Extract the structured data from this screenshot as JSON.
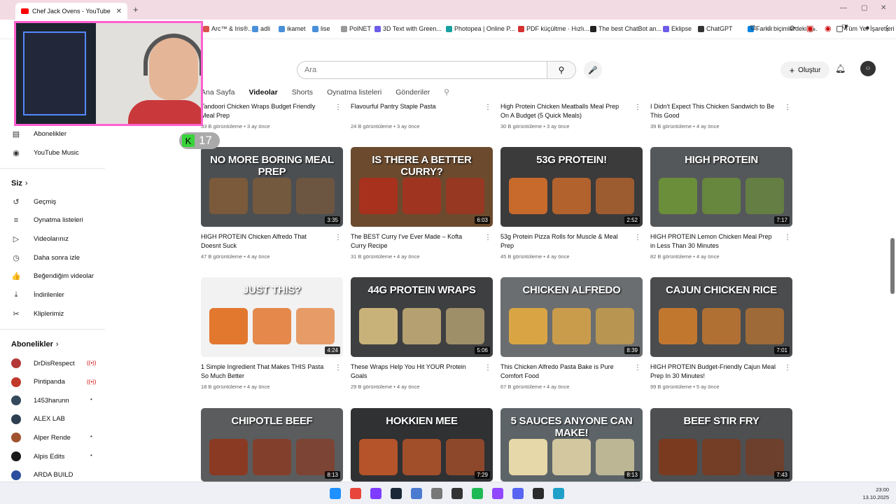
{
  "browser": {
    "tab_title": "Chef Jack Ovens - YouTube",
    "tab_close": "✕",
    "new_tab": "+",
    "bookmarks": [
      {
        "label": "Arc™ & Iris®...",
        "color": "#d9534f"
      },
      {
        "label": "adli",
        "color": "#4a90d9"
      },
      {
        "label": "ikamet",
        "color": "#4a90d9"
      },
      {
        "label": "lise",
        "color": "#4a90d9"
      },
      {
        "label": "PolNET",
        "color": "#999999"
      },
      {
        "label": "3D Text with Green...",
        "color": "#6c5ce7"
      },
      {
        "label": "Photopea | Online P...",
        "color": "#18a0a0"
      },
      {
        "label": "PDF küçültme · Hızlı...",
        "color": "#d63031"
      },
      {
        "label": "The best ChatBot an...",
        "color": "#222222"
      },
      {
        "label": "Eklipse",
        "color": "#6c5ce7"
      },
      {
        "label": "ChatGPT",
        "color": "#333333"
      },
      {
        "label": "Farklı biçimlerdeki g...",
        "color": "#0984e3"
      }
    ],
    "more_bookmarks": "»",
    "all_bookmarks": "Tüm Yer İşaretleri"
  },
  "header": {
    "search_placeholder": "Ara",
    "create_label": "Oluştur",
    "avatar_text": "⚇"
  },
  "channel_tabs": [
    {
      "label": "Ana Sayfa",
      "active": false
    },
    {
      "label": "Videolar",
      "active": true
    },
    {
      "label": "Shorts",
      "active": false
    },
    {
      "label": "Oynatma listeleri",
      "active": false
    },
    {
      "label": "Gönderiler",
      "active": false
    }
  ],
  "overlay": {
    "counter": "17",
    "k": "K"
  },
  "sidebar": {
    "top_items": [
      {
        "label": "Abonelikler",
        "icon": "subscriptions-icon",
        "glyph": "▤"
      },
      {
        "label": "YouTube Music",
        "icon": "music-icon",
        "glyph": "◉"
      }
    ],
    "you_header": "Siz",
    "you_items": [
      {
        "label": "Geçmiş",
        "icon": "history-icon",
        "glyph": "↺"
      },
      {
        "label": "Oynatma listeleri",
        "icon": "playlist-icon",
        "glyph": "≡"
      },
      {
        "label": "Videolarınız",
        "icon": "your-videos-icon",
        "glyph": "▷"
      },
      {
        "label": "Daha sonra izle",
        "icon": "watch-later-icon",
        "glyph": "◷"
      },
      {
        "label": "Beğendiğim videolar",
        "icon": "like-icon",
        "glyph": "👍"
      },
      {
        "label": "İndirilenler",
        "icon": "download-icon",
        "glyph": "⤓"
      },
      {
        "label": "Kliplerimiz",
        "icon": "clips-icon",
        "glyph": "✂"
      }
    ],
    "subs_header": "Abonelikler",
    "subs": [
      {
        "label": "DrDisRespect",
        "color": "#b33939",
        "status": "live"
      },
      {
        "label": "Pintipanda",
        "color": "#c0392b",
        "status": "live"
      },
      {
        "label": "1453harunn",
        "color": "#34495e",
        "status": "dot"
      },
      {
        "label": "ALEX LAB",
        "color": "#2c3e50",
        "status": ""
      },
      {
        "label": "Alper Rende",
        "color": "#a0522d",
        "status": "dot"
      },
      {
        "label": "Alpis Edits",
        "color": "#1a1a1a",
        "status": "dot"
      },
      {
        "label": "ARDA BUILD",
        "color": "#2b4f9e",
        "status": ""
      }
    ],
    "live_glyph": "((•))",
    "dot_glyph": "•"
  },
  "videos_top_row": [
    {
      "title": "Tandoori Chicken Wraps Budget Friendly Meal Prep",
      "meta": "33 B görüntüleme • 3 ay önce"
    },
    {
      "title": "Flavourful Pantry Staple Pasta",
      "meta": "24 B görüntüleme • 3 ay önce"
    },
    {
      "title": "High Protein Chicken Meatballs Meal Prep On A Budget (5 Quick Meals)",
      "meta": "30 B görüntüleme • 3 ay önce"
    },
    {
      "title": "I Didn't Expect This Chicken Sandwich to Be This Good",
      "meta": "39 B görüntüleme • 4 ay önce"
    }
  ],
  "videos": [
    {
      "thumb_text": "NO MORE BORING MEAL PREP",
      "duration": "3:35",
      "title": "HIGH PROTEIN Chicken Alfredo That Doesnt Suck",
      "meta": "47 B görüntüleme • 4 ay önce",
      "bg": "#4b4f52",
      "food": "#7a5a3a"
    },
    {
      "thumb_text": "IS THERE A BETTER CURRY?",
      "duration": "6:03",
      "title": "The BEST Curry I've Ever Made – Kofta Curry Recipe",
      "meta": "31 B görüntüleme • 4 ay önce",
      "bg": "#6b4a2e",
      "food": "#a8311e"
    },
    {
      "thumb_text": "53G PROTEIN!",
      "duration": "2:52",
      "title": "53g Protein Pizza Rolls for Muscle & Meal Prep",
      "meta": "45 B görüntüleme • 4 ay önce",
      "bg": "#3b3b3b",
      "food": "#c86a2c"
    },
    {
      "thumb_text": "HIGH PROTEIN",
      "duration": "7:17",
      "title": "HIGH PROTEIN Lemon Chicken Meal Prep in Less Than 30 Minutes",
      "meta": "82 B görüntüleme • 4 ay önce",
      "bg": "#55585a",
      "food": "#6b8e3a"
    },
    {
      "thumb_text": "JUST THIS?",
      "duration": "4:24",
      "title": "1 Simple Ingredient That Makes THIS Pasta So Much Better",
      "meta": "18 B görüntüleme • 4 ay önce",
      "bg": "#f2f2f2",
      "food": "#e2772e"
    },
    {
      "thumb_text": "44G PROTEIN WRAPS",
      "duration": "5:06",
      "title": "These Wraps Help You Hit YOUR Protein Goals",
      "meta": "29 B görüntüleme • 4 ay önce",
      "bg": "#3e3f41",
      "food": "#c9b27a"
    },
    {
      "thumb_text": "CHICKEN ALFREDO",
      "duration": "8:39",
      "title": "This Chicken Alfredo Pasta Bake is Pure Comfort Food",
      "meta": "67 B görüntüleme • 4 ay önce",
      "bg": "#6b6e70",
      "food": "#d9a544"
    },
    {
      "thumb_text": "CAJUN CHICKEN RICE",
      "duration": "7:01",
      "title": "HIGH PROTEIN Budget-Friendly Cajun Meal Prep In 30 Minutes!",
      "meta": "99 B görüntüleme • 5 ay önce",
      "bg": "#4a4c4e",
      "food": "#c2772f"
    },
    {
      "thumb_text": "CHIPOTLE BEEF",
      "duration": "8:13",
      "title": "",
      "meta": "",
      "bg": "#5a5c5e",
      "food": "#8a3a22"
    },
    {
      "thumb_text": "HOKKIEN MEE",
      "duration": "7:29",
      "title": "",
      "meta": "",
      "bg": "#2f3133",
      "food": "#b5532a"
    },
    {
      "thumb_text": "5 SAUCES ANYONE CAN MAKE!",
      "duration": "8:13",
      "title": "",
      "meta": "",
      "bg": "#5d6468",
      "food": "#e6d8a8"
    },
    {
      "thumb_text": "BEEF STIR FRY",
      "duration": "7:43",
      "title": "",
      "meta": "",
      "bg": "#4d4f51",
      "food": "#7a3a1f"
    }
  ],
  "taskbar": {
    "time": "23:00",
    "date": "13.10.2025",
    "apps": [
      {
        "name": "windows-start-icon",
        "color": "#1e90ff"
      },
      {
        "name": "chrome-icon",
        "color": "#e8453c"
      },
      {
        "name": "snipping-icon",
        "color": "#7d3cff"
      },
      {
        "name": "steam-icon",
        "color": "#1b2838"
      },
      {
        "name": "notepad-icon",
        "color": "#4a7bd0"
      },
      {
        "name": "clock-app-icon",
        "color": "#777777"
      },
      {
        "name": "terminal-icon",
        "color": "#333333"
      },
      {
        "name": "spotify-icon",
        "color": "#1db954"
      },
      {
        "name": "twitch-icon",
        "color": "#9146ff"
      },
      {
        "name": "discord-icon",
        "color": "#5865f2"
      },
      {
        "name": "obs-icon",
        "color": "#2b2b2b"
      },
      {
        "name": "settings-icon",
        "color": "#1fa0c8"
      }
    ]
  }
}
